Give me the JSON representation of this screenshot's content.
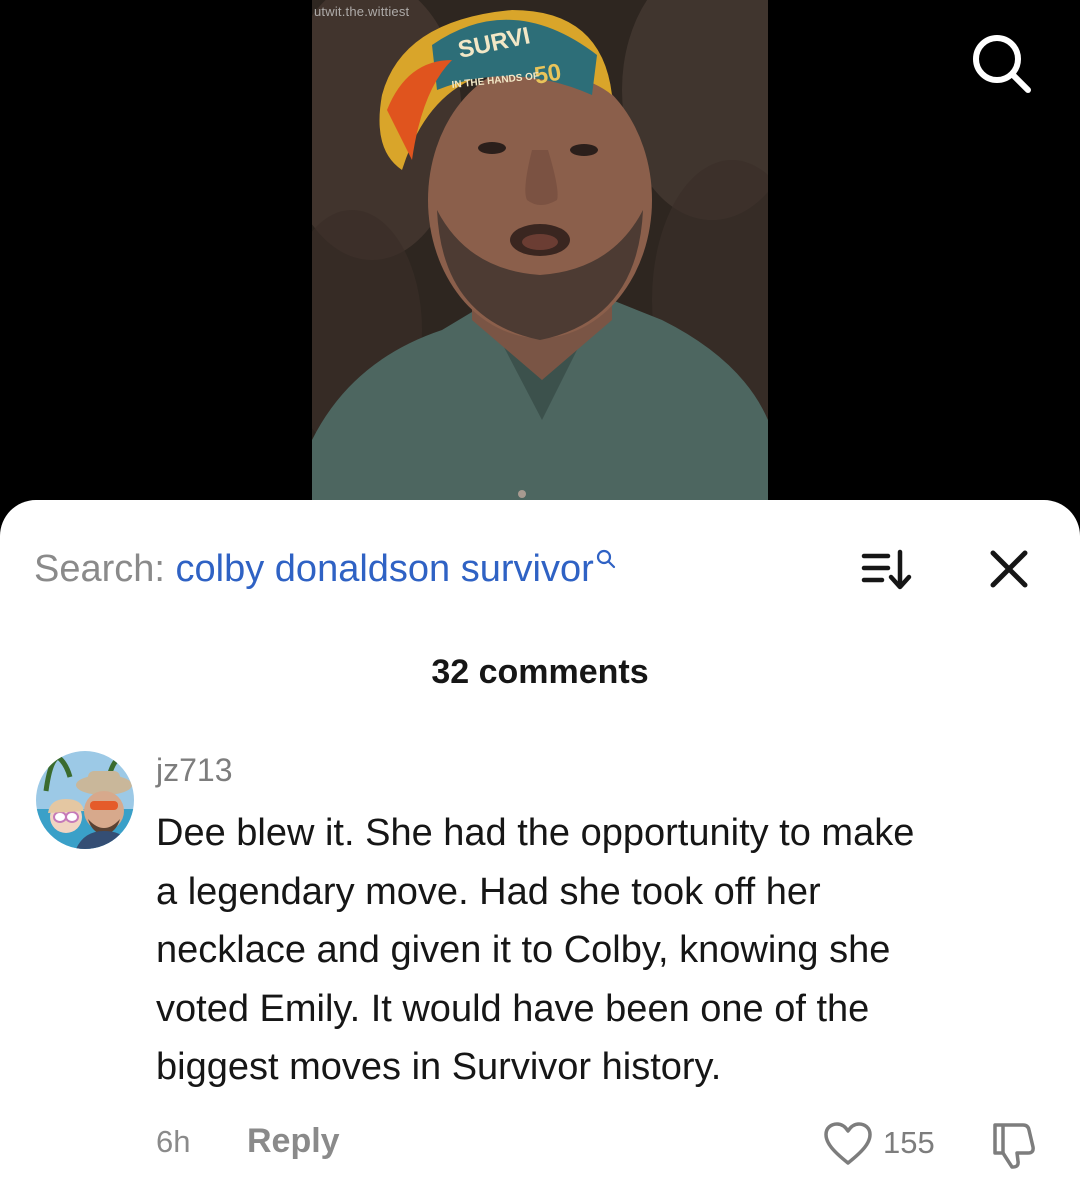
{
  "video": {
    "watermark": "utwit.the.wittiest",
    "bandana_text_main": "SURVI",
    "bandana_text_number": "50",
    "bandana_text_sub": "IN THE HANDS OF"
  },
  "search": {
    "prefix": "Search: ",
    "term": "colby donaldson survivor"
  },
  "comments": {
    "count_label": "32 comments",
    "items": [
      {
        "username": "jz713",
        "text_lines": [
          "Dee blew it. She had the opportunity to make",
          "a legendary move. Had she took off her",
          "necklace and given it to Colby, knowing she",
          "voted Emily. It would have been one of the",
          "biggest moves in Survivor history."
        ],
        "time": "6h",
        "reply_label": "Reply",
        "likes": "155"
      }
    ]
  },
  "icons": {
    "top_search": "search-icon",
    "inline_search": "search-icon",
    "sort": "sort-icon",
    "close": "close-icon",
    "like": "heart-icon",
    "dislike": "thumbs-down-icon"
  },
  "colors": {
    "background": "#000000",
    "sheet": "#ffffff",
    "search_term": "#2f62c4",
    "muted_text": "#8a8a8a",
    "body_text": "#161616"
  }
}
